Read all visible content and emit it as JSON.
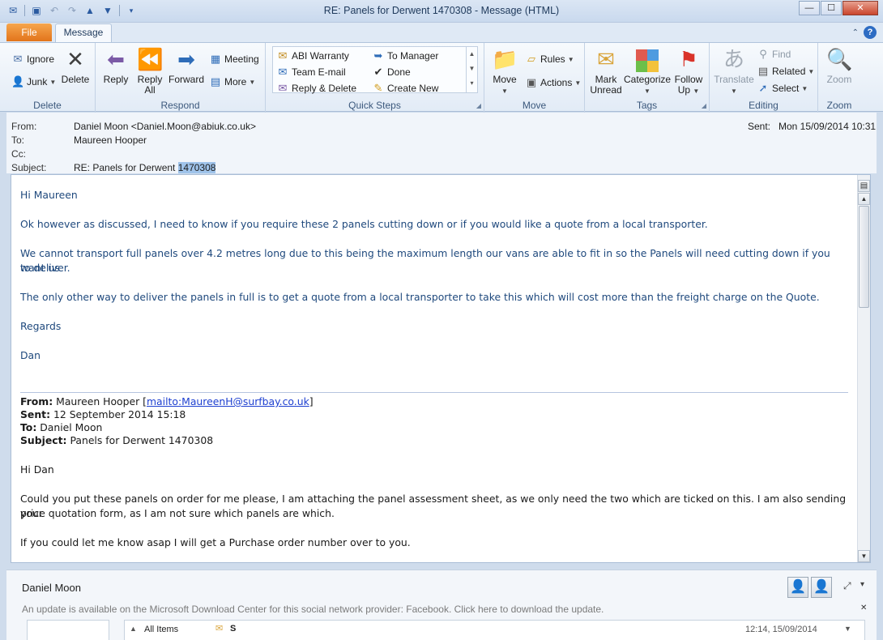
{
  "window": {
    "title": "RE: Panels for Derwent 1470308 - Message (HTML)",
    "minimize_label": "—",
    "maximize_label": "☐",
    "close_label": "✕"
  },
  "tabs": {
    "file": "File",
    "message": "Message"
  },
  "ribbon": {
    "delete": {
      "label": "Delete",
      "ignore": "Ignore",
      "junk": "Junk",
      "delete_btn": "Delete"
    },
    "respond": {
      "label": "Respond",
      "reply": "Reply",
      "reply_all_1": "Reply",
      "reply_all_2": "All",
      "forward": "Forward",
      "meeting": "Meeting",
      "more": "More"
    },
    "quick_steps": {
      "label": "Quick Steps",
      "items": [
        "ABI Warranty",
        "To Manager",
        "Team E-mail",
        "Done",
        "Reply & Delete",
        "Create New"
      ]
    },
    "move": {
      "label": "Move",
      "move_btn": "Move",
      "rules": "Rules",
      "actions": "Actions"
    },
    "tags": {
      "label": "Tags",
      "mark_unread_1": "Mark",
      "mark_unread_2": "Unread",
      "categorize": "Categorize",
      "follow_up_1": "Follow",
      "follow_up_2": "Up"
    },
    "editing": {
      "label": "Editing",
      "translate": "Translate",
      "find": "Find",
      "related": "Related",
      "select": "Select"
    },
    "zoom": {
      "label": "Zoom",
      "zoom_btn": "Zoom"
    }
  },
  "header": {
    "from_label": "From:",
    "from_value": "Daniel Moon <Daniel.Moon@abiuk.co.uk>",
    "to_label": "To:",
    "to_value": "Maureen Hooper",
    "cc_label": "Cc:",
    "subject_label": "Subject:",
    "subject_prefix": "RE: Panels for Derwent",
    "subject_highlight": "1470308",
    "sent_label": "Sent:",
    "sent_value": "Mon 15/09/2014 10:31"
  },
  "body": {
    "greeting": "Hi Maureen",
    "p1": "Ok however as discussed,  I need to know if you require these 2 panels cutting down or if you would like a quote from a local transporter.",
    "p2a": "We cannot transport full panels over 4.2 metres long due to this being the maximum length our vans are able to fit in so the Panels will need cutting down if you want us",
    "p2b": "to deliver.",
    "p3": "The only other way to deliver the panels in full is to get a quote from a local transporter to take this which will cost more than the freight charge on the Quote.",
    "regards": "Regards",
    "sign": "Dan",
    "quoted": {
      "from_label": "From:",
      "from_name": "Maureen Hooper",
      "from_link": "mailto:MaureenH@surfbay.co.uk",
      "sent_label": "Sent:",
      "sent_value": "12 September 2014 15:18",
      "to_label": "To:",
      "to_value": "Daniel Moon",
      "subject_label": "Subject:",
      "subject_value": "Panels for Derwent 1470308",
      "greeting": "Hi Dan",
      "p1a": "Could you put these panels on order for me please, I am attaching the panel assessment sheet, as we only need the two which are ticked on this.  I am also sending your",
      "p1b": "price quotation form, as I am not sure which panels are which.",
      "p2": "If you could let me know asap I will get a Purchase order number over to you."
    }
  },
  "people_pane": {
    "name": "Daniel Moon",
    "update_notice": "An update is available on the Microsoft Download Center for this social network provider: Facebook. Click here to download the update.",
    "all_items": "All Items",
    "item_sender": "S",
    "item_time": "12:14, 15/09/2014"
  },
  "colors": {
    "accent": "#e2741b",
    "body_text": "#1f497d",
    "highlight": "#9fc3ea",
    "link": "#1d3fd0"
  }
}
